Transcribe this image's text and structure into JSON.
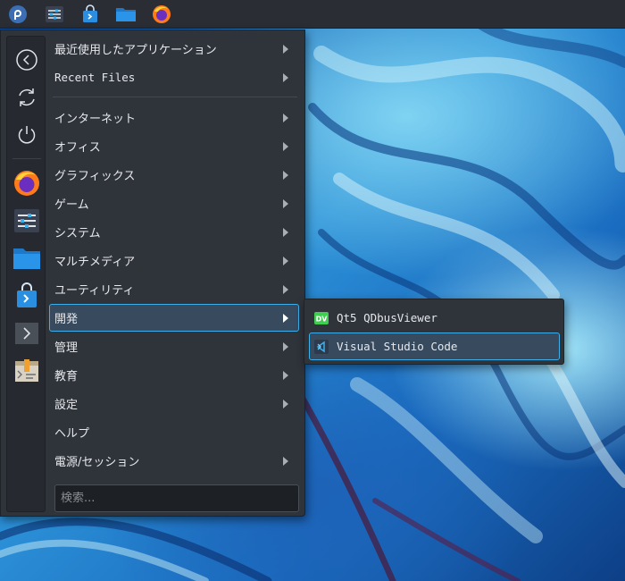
{
  "panel": {
    "icons": [
      {
        "name": "fedora-icon"
      },
      {
        "name": "system-settings-icon"
      },
      {
        "name": "software-store-icon"
      },
      {
        "name": "file-manager-icon"
      },
      {
        "name": "firefox-icon"
      }
    ]
  },
  "sidebar": {
    "buttons": [
      {
        "name": "back-icon"
      },
      {
        "name": "refresh-icon"
      },
      {
        "name": "power-icon"
      },
      {
        "name": "firefox-icon"
      },
      {
        "name": "system-settings-icon"
      },
      {
        "name": "folder-icon"
      },
      {
        "name": "software-store-icon"
      },
      {
        "name": "terminal-icon"
      },
      {
        "name": "archive-icon"
      }
    ]
  },
  "menu": {
    "top_items": [
      {
        "label": "最近使用したアプリケーション",
        "has_submenu": true
      },
      {
        "label": "Recent Files",
        "has_submenu": true
      }
    ],
    "categories": [
      {
        "label": "インターネット",
        "has_submenu": true
      },
      {
        "label": "オフィス",
        "has_submenu": true
      },
      {
        "label": "グラフィックス",
        "has_submenu": true
      },
      {
        "label": "ゲーム",
        "has_submenu": true
      },
      {
        "label": "システム",
        "has_submenu": true
      },
      {
        "label": "マルチメディア",
        "has_submenu": true
      },
      {
        "label": "ユーティリティ",
        "has_submenu": true
      },
      {
        "label": "開発",
        "has_submenu": true,
        "active": true
      },
      {
        "label": "管理",
        "has_submenu": true
      },
      {
        "label": "教育",
        "has_submenu": true
      },
      {
        "label": "設定",
        "has_submenu": true
      },
      {
        "label": "ヘルプ",
        "has_submenu": false
      },
      {
        "label": "電源/セッション",
        "has_submenu": true
      }
    ]
  },
  "search": {
    "placeholder": "検索..."
  },
  "submenu": {
    "items": [
      {
        "label": "Qt5 QDbusViewer",
        "icon": "qdbusviewer-icon",
        "icon_text": "DV"
      },
      {
        "label": "Visual Studio Code",
        "icon": "vscode-icon",
        "active": true
      }
    ]
  },
  "colors": {
    "accent": "#3daee9",
    "panel_bg": "#2a2e34",
    "menu_bg": "#2f333a",
    "highlight_bg": "#374a5e"
  }
}
